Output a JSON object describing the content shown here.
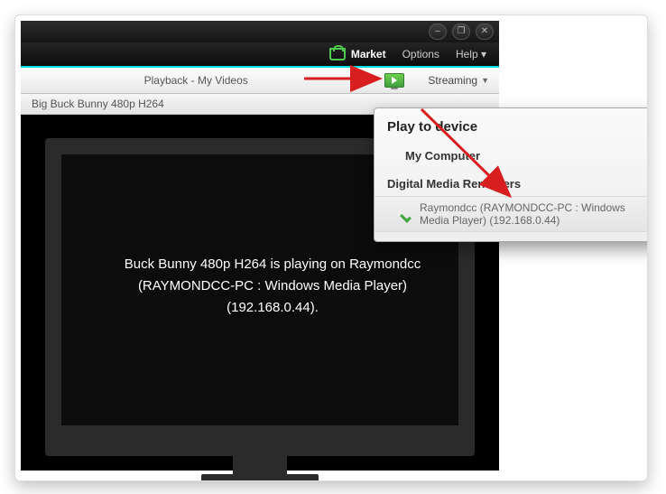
{
  "menubar": {
    "market": "Market",
    "options": "Options",
    "help": "Help"
  },
  "toolbar": {
    "breadcrumb": "Playback - My Videos",
    "streaming": "Streaming"
  },
  "track": {
    "title": "Big Buck Bunny 480p H264"
  },
  "status": {
    "line1": "Buck Bunny 480p H264 is playing on Raymondcc",
    "line2": "(RAYMONDCC-PC : Windows Media Player)",
    "line3": "(192.168.0.44)."
  },
  "dropdown": {
    "title": "Play to device",
    "my_computer": "My Computer",
    "section": "Digital Media Renderers",
    "device": "Raymondcc (RAYMONDCC-PC : Windows Media Player) (192.168.0.44)"
  },
  "icons": {
    "minimize": "–",
    "restore": "❐",
    "close": "✕",
    "help_arrow": "▾",
    "stream_arrow": "▼"
  }
}
